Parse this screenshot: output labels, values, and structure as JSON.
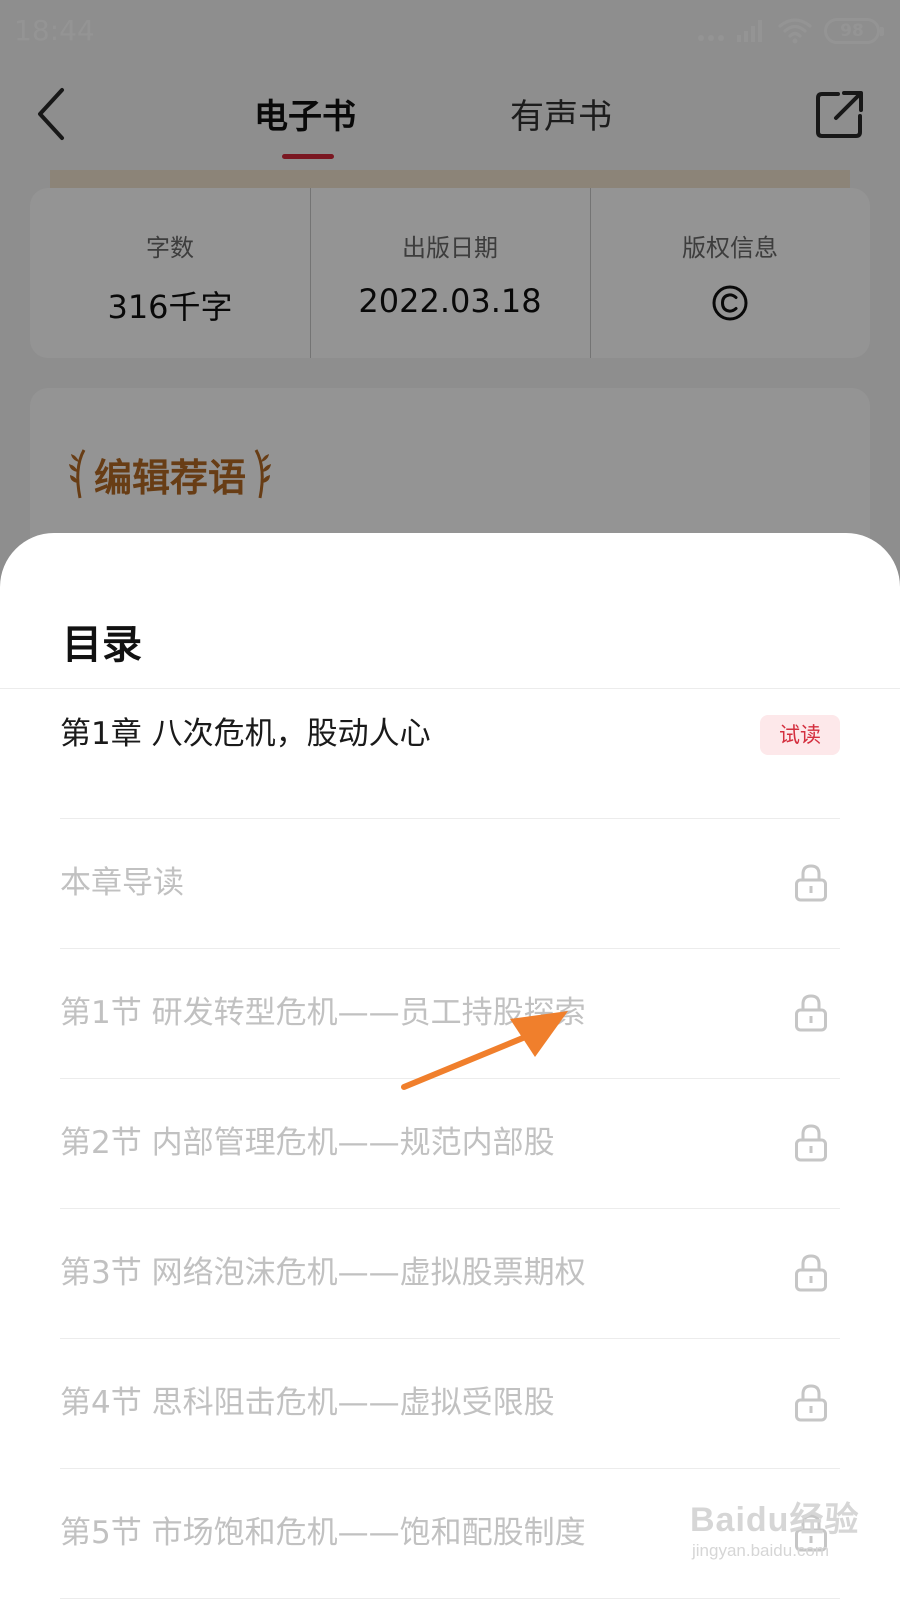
{
  "status_bar": {
    "time": "18:44",
    "battery": "98",
    "icons": [
      "signal-dots-icon",
      "cellular-signal-icon",
      "wifi-icon",
      "battery-icon"
    ]
  },
  "nav": {
    "back_icon": "chevron-left-icon",
    "tabs": [
      {
        "label": "电子书",
        "active": true
      },
      {
        "label": "有声书",
        "active": false
      }
    ],
    "share_icon": "share-external-icon",
    "active_color": "#d2283a"
  },
  "info_card": {
    "word_count": {
      "label": "字数",
      "value": "316千字"
    },
    "publish_date": {
      "label": "出版日期",
      "value": "2022.03.18"
    },
    "copyright": {
      "label": "版权信息",
      "icon": "copyright-icon"
    }
  },
  "editor_section": {
    "title": "编辑荐语",
    "title_color": "#b46a25"
  },
  "toc": {
    "title": "目录",
    "chapter": {
      "label": "第1章 八次危机，股动人心",
      "badge": "试读"
    },
    "items": [
      {
        "label": "本章导读",
        "locked": true
      },
      {
        "label": "第1节 研发转型危机——员工持股探索",
        "locked": true
      },
      {
        "label": "第2节 内部管理危机——规范内部股",
        "locked": true
      },
      {
        "label": "第3节 网络泡沫危机——虚拟股票期权",
        "locked": true
      },
      {
        "label": "第4节 思科阻击危机——虚拟受限股",
        "locked": true
      },
      {
        "label": "第5节 市场饱和危机——饱和配股制度",
        "locked": true
      }
    ],
    "badge_color": "#d42f3f",
    "locked_text_color": "#c1c1c1"
  },
  "annotation": {
    "icon": "orange-arrow-icon",
    "color": "#f07f2c"
  },
  "watermark": {
    "brand": "Baidu经验",
    "url": "jingyan.baidu.com"
  }
}
